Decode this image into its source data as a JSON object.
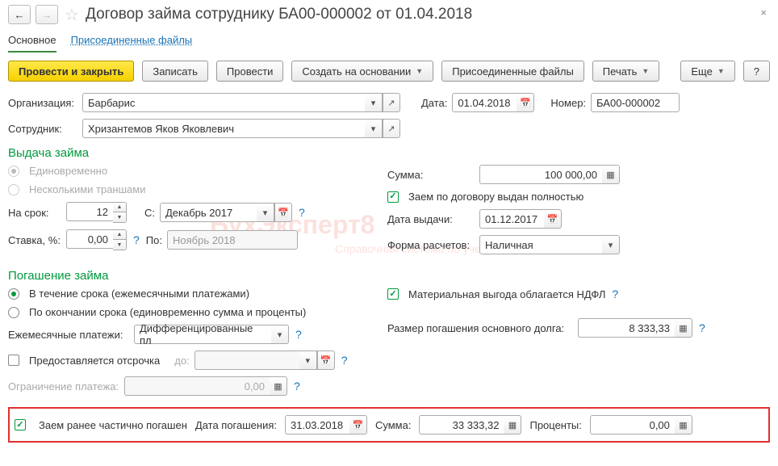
{
  "title": "Договор займа сотруднику БА00-000002 от 01.04.2018",
  "tabs": {
    "main": "Основное",
    "files": "Присоединенные файлы"
  },
  "toolbar": {
    "post_close": "Провести и закрыть",
    "save": "Записать",
    "post": "Провести",
    "create_based": "Создать на основании",
    "attached_files": "Присоединенные файлы",
    "print": "Печать",
    "more": "Еще",
    "help": "?"
  },
  "header": {
    "org_label": "Организация:",
    "org_value": "Барбарис",
    "date_label": "Дата:",
    "date_value": "01.04.2018",
    "number_label": "Номер:",
    "number_value": "БА00-000002",
    "employee_label": "Сотрудник:",
    "employee_value": "Хризантемов Яков Яковлевич"
  },
  "issuance": {
    "title": "Выдача займа",
    "once": "Единовременно",
    "tranches": "Несколькими траншами",
    "term_label": "На срок:",
    "term_value": "12",
    "from_label": "С:",
    "from_value": "Декабрь 2017",
    "rate_label": "Ставка, %:",
    "rate_value": "0,00",
    "to_label": "По:",
    "to_value": "Ноябрь 2018",
    "sum_label": "Сумма:",
    "sum_value": "100 000,00",
    "fully_issued": "Заем по договору выдан полностью",
    "issue_date_label": "Дата выдачи:",
    "issue_date_value": "01.12.2017",
    "settlement_label": "Форма расчетов:",
    "settlement_value": "Наличная"
  },
  "repayment": {
    "title": "Погашение займа",
    "during": "В течение срока (ежемесячными платежами)",
    "after": "По окончании срока (единовременно сумма и проценты)",
    "monthly_label": "Ежемесячные платежи:",
    "monthly_value": "Дифференцированные пл",
    "defer_label": "Предоставляется отсрочка",
    "defer_to": "до:",
    "limit_label": "Ограничение платежа:",
    "limit_value": "0,00",
    "benefit_label": "Материальная выгода облагается НДФЛ",
    "principal_label": "Размер погашения основного долга:",
    "principal_value": "8 333,33"
  },
  "partial": {
    "label": "Заем ранее частично погашен",
    "date_label": "Дата погашения:",
    "date_value": "31.03.2018",
    "sum_label": "Сумма:",
    "sum_value": "33 333,32",
    "interest_label": "Проценты:",
    "interest_value": "0,00"
  },
  "icons": {
    "calendar": "📅",
    "open": "↗",
    "calc": "▦",
    "dropdown": "▾",
    "clear": "×"
  },
  "watermark": {
    "t1": "БухЭксперт8",
    "t2": "Справочная система по учету в 1С"
  }
}
